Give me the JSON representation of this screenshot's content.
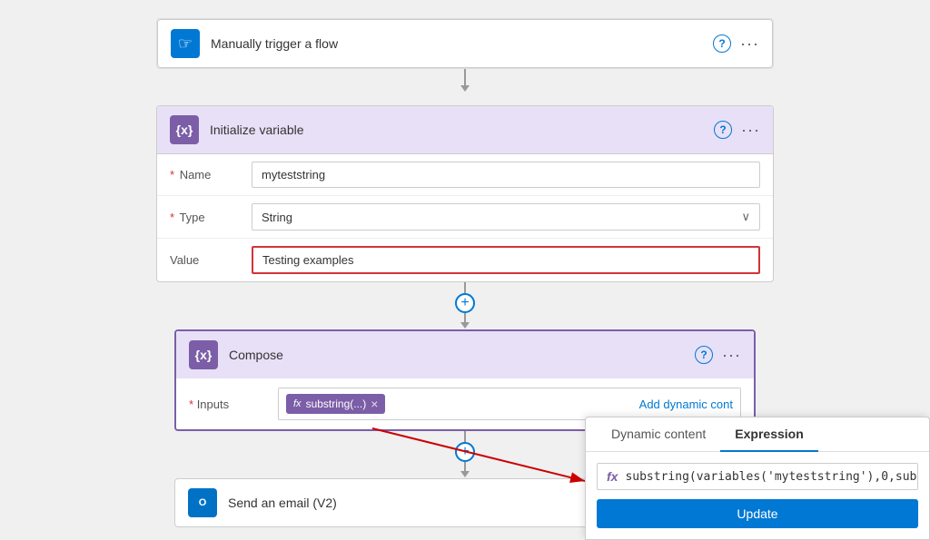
{
  "trigger": {
    "title": "Manually trigger a flow",
    "icon": "hand",
    "icon_color": "#0078d4"
  },
  "init_variable": {
    "title": "Initialize variable",
    "icon": "curly",
    "icon_color": "#7b5ea7",
    "fields": {
      "name_label": "Name",
      "name_value": "myteststring",
      "type_label": "Type",
      "type_value": "String",
      "value_label": "Value",
      "value_value": "Testing examples"
    }
  },
  "compose": {
    "title": "Compose",
    "icon": "curly",
    "icon_color": "#7b5ea7",
    "inputs_label": "Inputs",
    "tag_label": "substring(...)",
    "add_dynamic_label": "Add dynamic cont"
  },
  "send_email": {
    "title": "Send an email (V2)",
    "icon": "outlook",
    "icon_color": "#0072c6"
  },
  "dynamic_panel": {
    "tab1": "Dynamic content",
    "tab2": "Expression",
    "expression_value": "substring(variables('myteststring'),0,sub",
    "update_label": "Update"
  },
  "icons": {
    "help": "?",
    "more": "···",
    "plus": "+",
    "arrow_down": "▼",
    "fx": "fx",
    "close": "×"
  }
}
